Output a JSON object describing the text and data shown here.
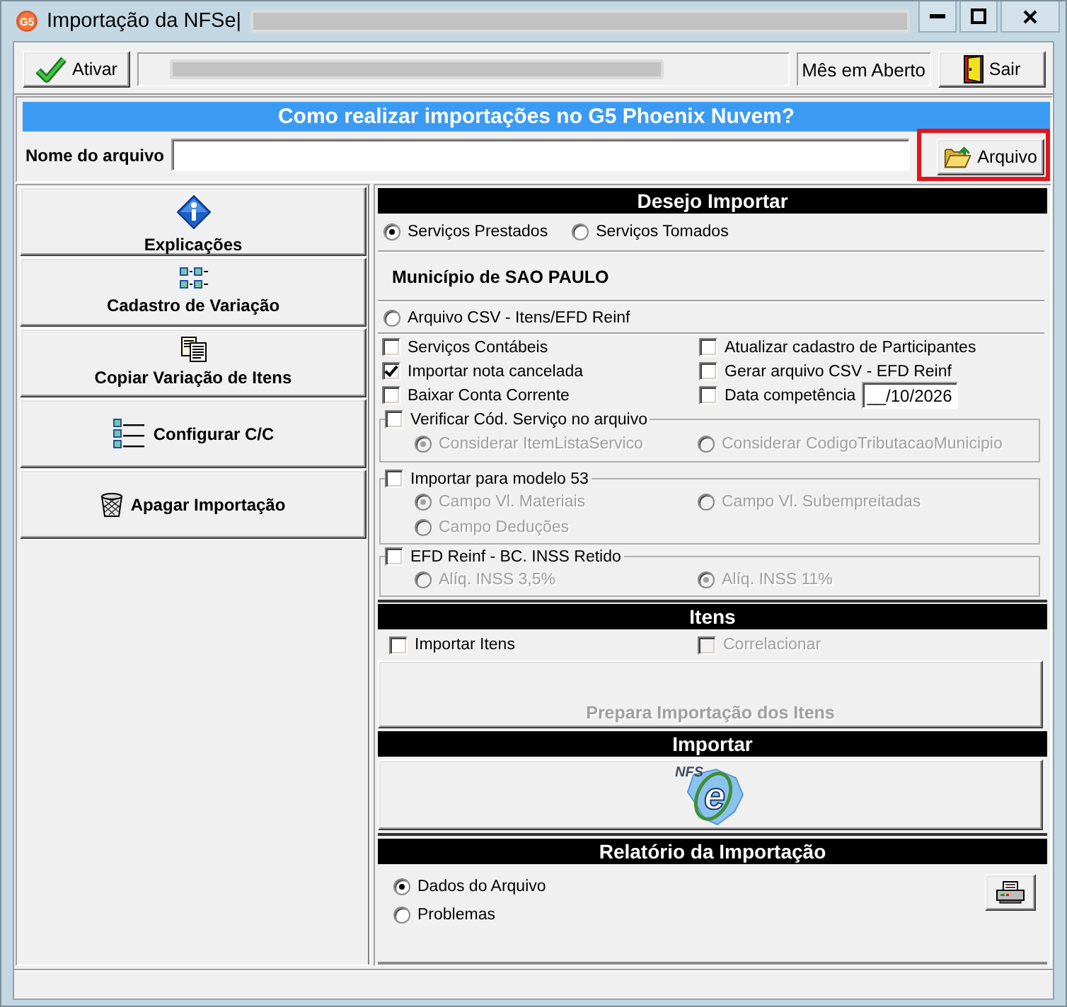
{
  "window": {
    "app_icon_text": "G5",
    "title": "Importação da NFSe|",
    "title_redacted": true
  },
  "toolbar": {
    "activate_button": "Ativar",
    "company_redacted": true,
    "period_status": "Mês em Aberto",
    "exit_button": "Sair"
  },
  "help_banner": "Como realizar importações no G5 Phoenix Nuvem?",
  "file_picker": {
    "label": "Nome do arquivo",
    "button": "Arquivo",
    "highlighted": true
  },
  "sidebar": {
    "items": [
      {
        "kind": "info",
        "label": "Explicações"
      },
      {
        "kind": "variation",
        "label": "Cadastro de Variação"
      },
      {
        "kind": "copy",
        "label": "Copiar Variação de Itens"
      },
      {
        "kind": "list",
        "label": "Configurar C/C"
      },
      {
        "kind": "delete",
        "label": "Apagar Importação"
      }
    ]
  },
  "import_options": {
    "title": "Desejo Importar",
    "service_types": [
      {
        "label": "Serviços Prestados",
        "selected": true
      },
      {
        "label": "Serviços Tomados",
        "selected": false
      }
    ],
    "municipality": "Município de SAO PAULO",
    "csv_source": {
      "label": "Arquivo CSV - Itens/EFD Reinf",
      "selected": false
    },
    "checkboxes": [
      {
        "label": "Serviços Contábeis",
        "checked": false
      },
      {
        "label": "Atualizar cadastro de Participantes",
        "checked": false
      },
      {
        "label": "Importar nota cancelada",
        "checked": true
      },
      {
        "label": "Gerar arquivo CSV - EFD Reinf",
        "checked": false
      },
      {
        "label": "Baixar Conta Corrente",
        "checked": false
      },
      {
        "label": "Data competência",
        "checked": false,
        "date_value": "__/10/2026"
      }
    ],
    "groups": [
      {
        "label": "Verificar Cód. Serviço no arquivo",
        "checked": false,
        "choices": [
          {
            "label": "Considerar ItemListaServico",
            "selected": true,
            "disabled": true
          },
          {
            "label": "Considerar CodigoTributacaoMunicipio",
            "selected": false,
            "disabled": true
          }
        ]
      },
      {
        "label": "Importar para modelo 53",
        "checked": false,
        "choices": [
          {
            "label": "Campo Vl. Materiais",
            "selected": true,
            "disabled": true
          },
          {
            "label": "Campo Vl. Subempreitadas",
            "selected": false,
            "disabled": true
          },
          {
            "label": "Campo Deduções",
            "selected": false,
            "disabled": true
          }
        ]
      },
      {
        "label": "EFD Reinf - BC. INSS Retido",
        "checked": false,
        "choices": [
          {
            "label": "Alíq. INSS 3,5%",
            "selected": false,
            "disabled": true
          },
          {
            "label": "Alíq. INSS 11%",
            "selected": true,
            "disabled": true
          }
        ]
      }
    ]
  },
  "items": {
    "title": "Itens",
    "checkboxes": [
      {
        "label": "Importar Itens",
        "checked": false,
        "disabled": false
      },
      {
        "label": "Correlacionar",
        "checked": false,
        "disabled": true
      }
    ],
    "prepare_button": {
      "label": "Prepara Importação dos Itens",
      "disabled": true
    }
  },
  "import": {
    "title": "Importar",
    "logo_text": "NFS",
    "logo_letter": "e"
  },
  "report": {
    "title": "Relatório da Importação",
    "options": [
      {
        "label": "Dados do Arquivo",
        "selected": true
      },
      {
        "label": "Problemas",
        "selected": false
      }
    ]
  }
}
